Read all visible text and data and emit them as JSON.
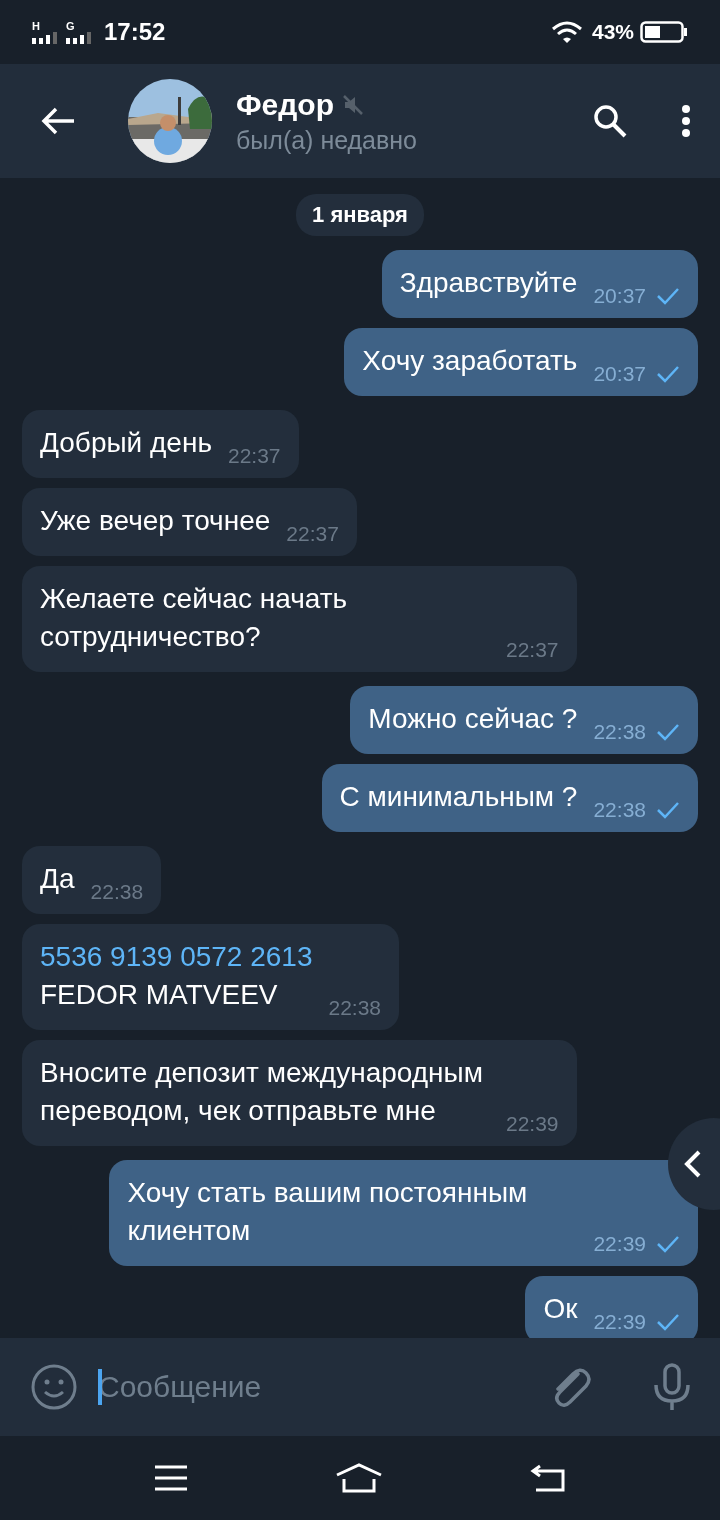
{
  "status_bar": {
    "networks": [
      {
        "label": "H"
      },
      {
        "label": "G"
      }
    ],
    "time": "17:52",
    "battery": "43%"
  },
  "header": {
    "name": "Федор",
    "muted": true,
    "status": "был(а) недавно"
  },
  "date_chip": "1 января",
  "messages": [
    {
      "kind": "outgoing",
      "text": "Здравствуйте",
      "time": "20:37",
      "read": false
    },
    {
      "kind": "outgoing",
      "text": "Хочу заработать",
      "time": "20:37",
      "read": false
    },
    {
      "kind": "incoming",
      "text": "Добрый день",
      "time": "22:37"
    },
    {
      "kind": "incoming",
      "text": "Уже вечер точнее",
      "time": "22:37"
    },
    {
      "kind": "incoming",
      "text": "Желаете сейчас начать сотрудничество?",
      "time": "22:37"
    },
    {
      "kind": "outgoing",
      "text": "Можно сейчас ?",
      "time": "22:38",
      "read": false
    },
    {
      "kind": "outgoing",
      "text": "С минимальным ?",
      "time": "22:38",
      "read": false
    },
    {
      "kind": "incoming",
      "text": "Да",
      "time": "22:38"
    },
    {
      "kind": "incoming",
      "link": "5536 9139 0572 2613",
      "text": "FEDOR MATVEEV",
      "time": "22:38"
    },
    {
      "kind": "incoming",
      "text": "Вносите депозит международным переводом, чек отправьте мне",
      "time": "22:39"
    },
    {
      "kind": "outgoing",
      "text": "Хочу стать вашим постоянным клиентом",
      "time": "22:39",
      "read": false
    },
    {
      "kind": "outgoing",
      "text": "Ок",
      "time": "22:39",
      "read": false
    }
  ],
  "composer": {
    "placeholder": "Сообщение",
    "focused": true
  }
}
